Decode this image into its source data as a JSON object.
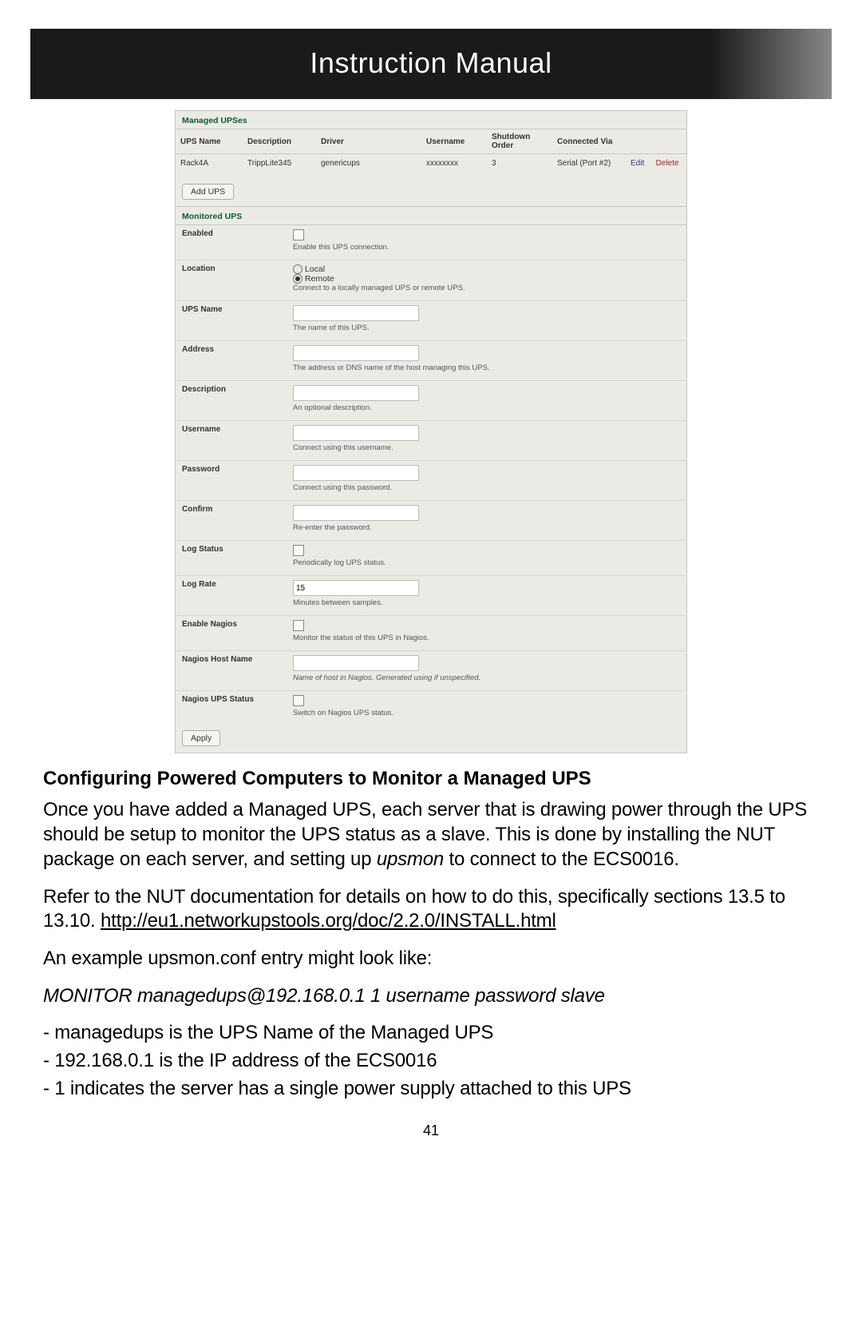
{
  "header": {
    "title": "Instruction Manual"
  },
  "managed": {
    "title": "Managed UPSes",
    "cols": {
      "c1": "UPS Name",
      "c2": "Description",
      "c3": "Driver",
      "c4": "Username",
      "c5": "Shutdown Order",
      "c6": "Connected Via"
    },
    "row": {
      "name": "Rack4A",
      "desc": "TrippLite345",
      "driver": "genericups",
      "user": "xxxxxxxx",
      "order": "3",
      "via": "Serial (Port #2)",
      "edit": "Edit",
      "del": "Delete"
    },
    "add_btn": "Add UPS"
  },
  "monitored": {
    "title": "Monitored UPS",
    "enabled": {
      "label": "Enabled",
      "help": "Enable this UPS connection."
    },
    "location": {
      "label": "Location",
      "opt_local": "Local",
      "opt_remote": "Remote",
      "help": "Connect to a locally managed UPS or remote UPS."
    },
    "upsname": {
      "label": "UPS Name",
      "help": "The name of this UPS."
    },
    "address": {
      "label": "Address",
      "help": "The address or DNS name of the host managing this UPS."
    },
    "description": {
      "label": "Description",
      "help": "An optional description."
    },
    "username": {
      "label": "Username",
      "help": "Connect using this username."
    },
    "password": {
      "label": "Password",
      "help": "Connect using this password."
    },
    "confirm": {
      "label": "Confirm",
      "help": "Re-enter the password."
    },
    "logstatus": {
      "label": "Log Status",
      "help": "Periodically log UPS status."
    },
    "lograte": {
      "label": "Log Rate",
      "value": "15",
      "help": "Minutes between samples."
    },
    "enablenagios": {
      "label": "Enable Nagios",
      "help": "Monitor the status of this UPS in Nagios."
    },
    "nagioshost": {
      "label": "Nagios Host Name",
      "help": "Name of host in Nagios. Generated using if unspecified."
    },
    "nagiosstatus": {
      "label": "Nagios UPS Status",
      "help": "Switch on Nagios UPS status."
    },
    "apply_btn": "Apply"
  },
  "body": {
    "heading": "Configuring Powered Computers to Monitor a Managed UPS",
    "p1a": "Once you have added a Managed UPS, each server that is drawing power through the UPS should be setup to monitor the UPS status as a slave. This is done by installing the NUT package on each server, and setting up ",
    "p1b": "upsmon",
    "p1c": " to connect to the ECS0016.",
    "p2a": "Refer to the NUT documentation for details on how to do this, specifically sections 13.5 to 13.10. ",
    "p2link": "http://eu1.networkupstools.org/doc/2.2.0/INSTALL.html",
    "p3": "An example upsmon.conf entry might look like:",
    "p4": "MONITOR managedups@192.168.0.1 1 username password slave",
    "b1": "- managedups is the UPS Name of the Managed UPS",
    "b2": "- 192.168.0.1 is the IP address of the ECS0016",
    "b3": "- 1 indicates the server has a single power supply attached to this UPS"
  },
  "page_number": "41"
}
